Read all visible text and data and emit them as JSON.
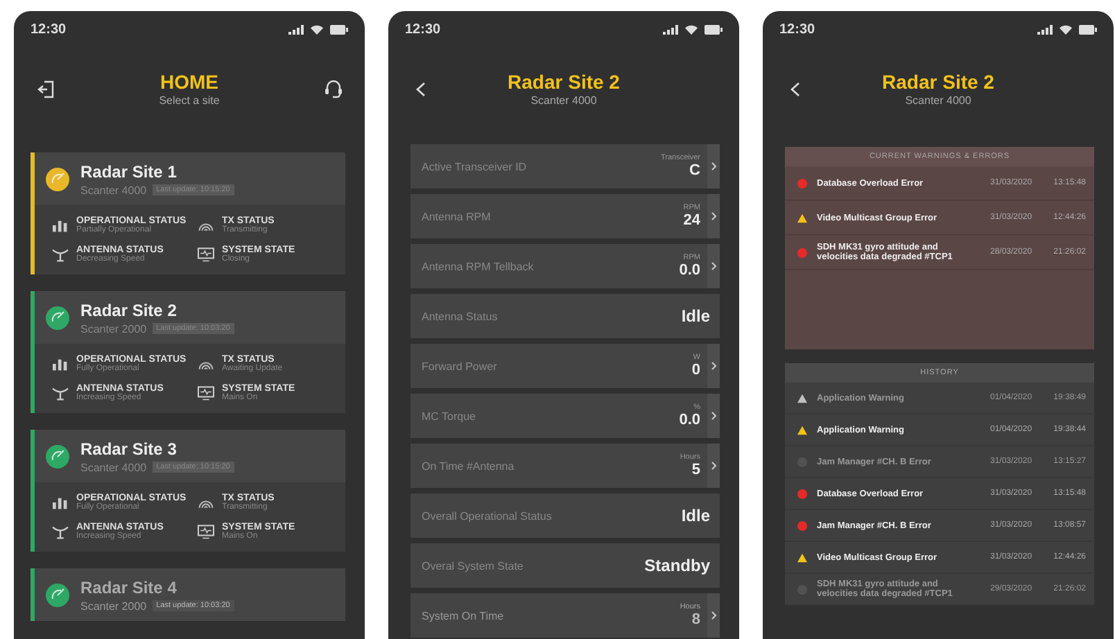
{
  "screens": [
    {
      "kind": "home",
      "status_bar": {
        "time": "12:30"
      },
      "header": {
        "title": "HOME",
        "subtitle": "Select a site"
      },
      "sites": [
        {
          "name": "Radar Site 1",
          "model": "Scanter 4000",
          "updated": "Last update: 10:15:20",
          "color": "#e8b82a",
          "faded": false,
          "statuses": [
            {
              "kind": "operational",
              "label": "OPERATIONAL STATUS",
              "value": "Partially Operational"
            },
            {
              "kind": "tx",
              "label": "TX STATUS",
              "value": "Transmitting"
            },
            {
              "kind": "antenna",
              "label": "ANTENNA STATUS",
              "value": "Decreasing Speed"
            },
            {
              "kind": "system",
              "label": "SYSTEM STATE",
              "value": "Closing"
            }
          ]
        },
        {
          "name": "Radar Site 2",
          "model": "Scanter 2000",
          "updated": "Last update: 10:03:20",
          "color": "#2fa866",
          "faded": false,
          "statuses": [
            {
              "kind": "operational",
              "label": "OPERATIONAL STATUS",
              "value": "Fully Operational"
            },
            {
              "kind": "tx",
              "label": "TX STATUS",
              "value": "Awaiting Update"
            },
            {
              "kind": "antenna",
              "label": "ANTENNA STATUS",
              "value": "Increasing Speed"
            },
            {
              "kind": "system",
              "label": "SYSTEM STATE",
              "value": "Mains On"
            }
          ]
        },
        {
          "name": "Radar Site 3",
          "model": "Scanter 4000",
          "updated": "Last update: 10:15:20",
          "color": "#2fa866",
          "faded": false,
          "statuses": [
            {
              "kind": "operational",
              "label": "OPERATIONAL STATUS",
              "value": "Fully Operational"
            },
            {
              "kind": "tx",
              "label": "TX STATUS",
              "value": "Transmitting"
            },
            {
              "kind": "antenna",
              "label": "ANTENNA STATUS",
              "value": "Increasing Speed"
            },
            {
              "kind": "system",
              "label": "SYSTEM STATE",
              "value": "Mains On"
            }
          ]
        },
        {
          "name": "Radar Site 4",
          "model": "Scanter 2000",
          "updated": "Last update: 10:03:20",
          "color": "#2fa866",
          "faded": true
        }
      ]
    },
    {
      "kind": "detail",
      "status_bar": {
        "time": "12:30"
      },
      "header": {
        "title": "Radar Site 2",
        "subtitle": "Scanter 4000"
      },
      "rows": [
        {
          "kind": "reading",
          "label": "Active Transceiver ID",
          "unit": "Transceiver",
          "value": "C",
          "faded": false
        },
        {
          "kind": "reading",
          "label": "Antenna RPM",
          "unit": "RPM",
          "value": "24",
          "faded": false
        },
        {
          "kind": "reading",
          "label": "Antenna RPM Tellback",
          "unit": "RPM",
          "value": "0.0",
          "faded": false
        },
        {
          "kind": "state",
          "label": "Antenna Status",
          "value": "Idle",
          "faded": false
        },
        {
          "kind": "reading",
          "label": "Forward Power",
          "unit": "W",
          "value": "0",
          "faded": false
        },
        {
          "kind": "reading",
          "label": "MC Torque",
          "unit": "%",
          "value": "0.0",
          "faded": false
        },
        {
          "kind": "reading",
          "label": "On Time #Antenna",
          "unit": "Hours",
          "value": "5",
          "faded": false
        },
        {
          "kind": "state",
          "label": "Overall Operational Status",
          "value": "Idle",
          "faded": false
        },
        {
          "kind": "state",
          "label": "Overal System State",
          "value": "Standby",
          "faded": false
        },
        {
          "kind": "reading",
          "label": "System On Time",
          "unit": "Hours",
          "value": "8",
          "faded": true
        }
      ]
    },
    {
      "kind": "alarms",
      "status_bar": {
        "time": "12:30"
      },
      "header": {
        "title": "Radar Site 2",
        "subtitle": "Scanter 4000"
      },
      "current": {
        "title": "CURRENT WARNINGS & ERRORS",
        "items": [
          {
            "kind": "error",
            "text": "Database Overload Error",
            "date": "31/03/2020",
            "time": "13:15:48",
            "faded": false
          },
          {
            "kind": "warning",
            "text": "Video Multicast Group Error",
            "date": "31/03/2020",
            "time": "12:44:26",
            "faded": false
          },
          {
            "kind": "error",
            "text": "SDH MK31 gyro attitude and velocities data degraded #TCP1",
            "date": "28/03/2020",
            "time": "21:26:02",
            "faded": false
          }
        ]
      },
      "history": {
        "title": "HISTORY",
        "items": [
          {
            "kind": "warning",
            "text": "Application Warning",
            "date": "01/04/2020",
            "time": "19:38:49",
            "faded": true
          },
          {
            "kind": "warning",
            "text": "Application Warning",
            "date": "01/04/2020",
            "time": "19:38:44",
            "faded": false
          },
          {
            "kind": "error",
            "text": "Jam Manager #CH. B Error",
            "date": "31/03/2020",
            "time": "13:15:27",
            "faded": true
          },
          {
            "kind": "error",
            "text": "Database Overload Error",
            "date": "31/03/2020",
            "time": "13:15:48",
            "faded": false
          },
          {
            "kind": "error",
            "text": "Jam Manager #CH. B Error",
            "date": "31/03/2020",
            "time": "13:08:57",
            "faded": false
          },
          {
            "kind": "warning",
            "text": "Video Multicast Group Error",
            "date": "31/03/2020",
            "time": "12:44:26",
            "faded": false
          },
          {
            "kind": "error",
            "text": "SDH MK31 gyro attitude and velocities data degraded #TCP1",
            "date": "29/03/2020",
            "time": "21:26:02",
            "faded": true
          }
        ]
      }
    }
  ]
}
